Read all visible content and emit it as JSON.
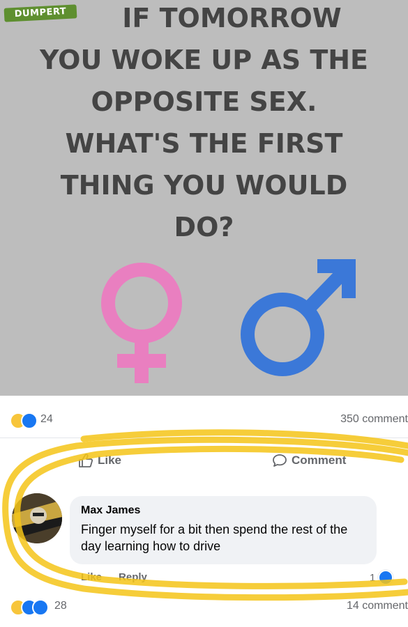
{
  "meme": {
    "watermark": "DUMPERT",
    "headline_lines": [
      "IF TOMORROW",
      "YOU WOKE UP AS THE",
      "OPPOSITE SEX.",
      "WHAT'S THE FIRST",
      "THING YOU WOULD",
      "DO?"
    ],
    "female_symbol_color": "#e97fc0",
    "male_symbol_color": "#3b78d8"
  },
  "post": {
    "reaction_count": "24",
    "comment_count": "350 comment",
    "like_label": "Like",
    "comment_label": "Comment"
  },
  "comment": {
    "author": "Max James",
    "text": "Finger myself for a bit then spend the rest of the day learning how to drive",
    "like_label": "Like",
    "reply_label": "Reply",
    "reaction_badge": "1"
  },
  "footer": {
    "reaction_count": "28",
    "comment_count": "14 comment"
  },
  "colors": {
    "highlight": "#f5c518",
    "facebook_blue": "#1877f2"
  }
}
